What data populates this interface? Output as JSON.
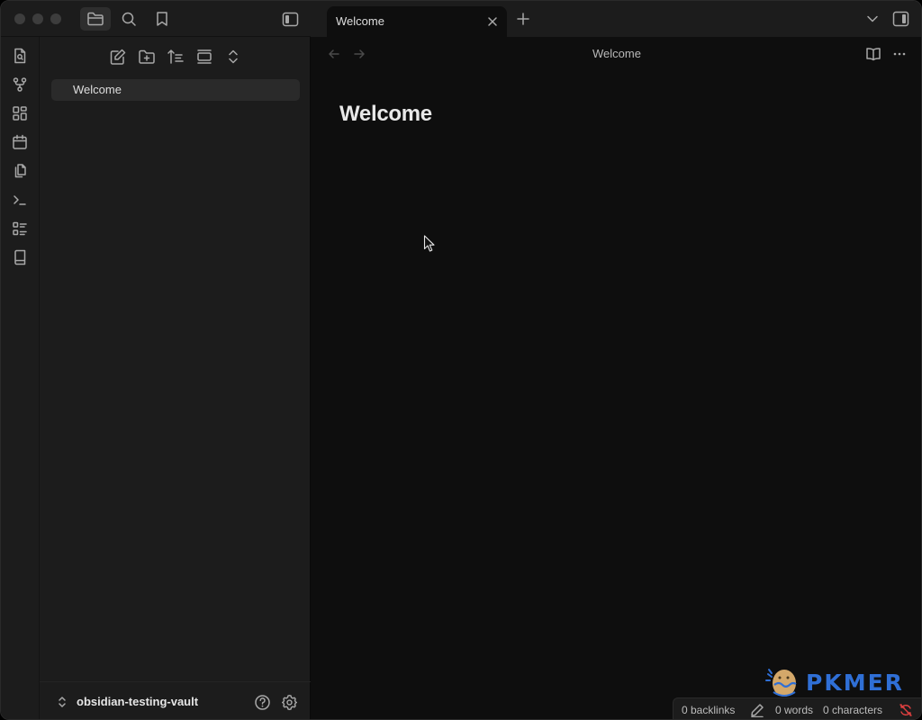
{
  "window": {
    "traffic_lights": [
      "close",
      "minimize",
      "zoom"
    ]
  },
  "titlebar": {
    "left_buttons": [
      {
        "name": "file-explorer",
        "icon": "folder-icon",
        "active": true
      },
      {
        "name": "search",
        "icon": "search-icon",
        "active": false
      },
      {
        "name": "bookmarks",
        "icon": "bookmark-icon",
        "active": false
      }
    ],
    "sidebar_toggle_icon": "sidebar-left-icon"
  },
  "ribbon": {
    "items": [
      {
        "name": "open-quick-switcher",
        "icon": "file-search-icon"
      },
      {
        "name": "open-graph-view",
        "icon": "git-fork-icon"
      },
      {
        "name": "open-canvas",
        "icon": "layout-dashboard-icon"
      },
      {
        "name": "open-daily-note",
        "icon": "calendar-icon"
      },
      {
        "name": "insert-template",
        "icon": "files-icon"
      },
      {
        "name": "open-command-palette",
        "icon": "terminal-icon"
      },
      {
        "name": "open-outline",
        "icon": "list-checks-icon"
      },
      {
        "name": "open-vault-book",
        "icon": "book-icon"
      }
    ]
  },
  "sidebar": {
    "nav_buttons": [
      {
        "name": "new-note",
        "icon": "edit-icon"
      },
      {
        "name": "new-folder",
        "icon": "folder-plus-icon"
      },
      {
        "name": "change-sort-order",
        "icon": "sort-icon"
      },
      {
        "name": "auto-reveal",
        "icon": "gallery-icon"
      },
      {
        "name": "collapse-all",
        "icon": "chevrons-up-down-icon"
      }
    ],
    "files": [
      {
        "label": "Welcome",
        "active": true
      }
    ],
    "vault": {
      "name": "obsidian-testing-vault",
      "switcher_icon": "chevrons-up-down-icon",
      "help_icon": "help-circle-icon",
      "settings_icon": "gear-icon"
    }
  },
  "tabs": {
    "items": [
      {
        "title": "Welcome",
        "active": true
      }
    ],
    "new_tab_icon": "plus-icon",
    "tab_list_icon": "chevron-down-icon",
    "right_sidebar_icon": "sidebar-right-icon"
  },
  "editor": {
    "view_title": "Welcome",
    "back_icon": "arrow-left-icon",
    "forward_icon": "arrow-right-icon",
    "reading_view_icon": "book-open-icon",
    "more_options_icon": "more-horizontal-icon",
    "heading": "Welcome"
  },
  "statusbar": {
    "backlinks": "0 backlinks",
    "words": "0 words",
    "characters": "0 characters",
    "editing_icon": "pencil-icon",
    "sync_icon": "sync-off-icon"
  },
  "watermark": {
    "text": "PKMER"
  },
  "colors": {
    "background": "#0e0e0e",
    "sidebar": "#1c1c1c",
    "text": "#dadada",
    "muted_icon": "#a8a8a8",
    "watermark_blue": "#2f6fd6",
    "sync_error": "#e04040"
  }
}
